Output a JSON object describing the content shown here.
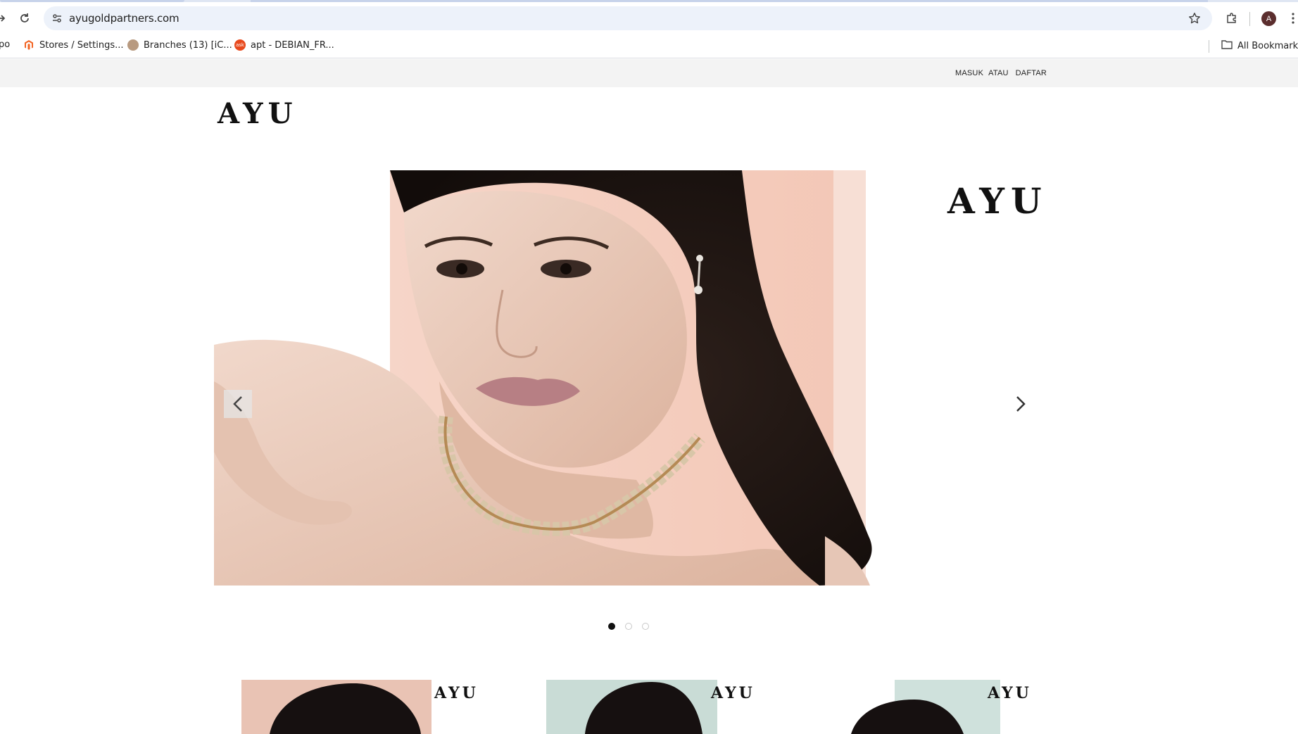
{
  "browser": {
    "url": "ayugoldpartners.com",
    "profile_initial": "A",
    "bookmarks": [
      {
        "label": "po",
        "color": "#ffffff"
      },
      {
        "label": "Stores / Settings...",
        "color": "#f26322"
      },
      {
        "label": "Branches (13) [iC...",
        "color": "#7a5c44"
      },
      {
        "label": "apt - DEBIAN_FR...",
        "color": "#e8491d"
      }
    ],
    "all_bookmarks": "All Bookmarks"
  },
  "site": {
    "topbar": {
      "login": "MASUK",
      "or": "ATAU",
      "register": "DAFTAR"
    },
    "logo": "AYU",
    "hero": {
      "brand_text": "AYU",
      "slides_count": 3,
      "active_slide": 0
    },
    "promos": [
      {
        "brand_text": "AYU",
        "bg": "#e9c3b4"
      },
      {
        "brand_text": "AYU",
        "bg": "#c9dcd6"
      },
      {
        "brand_text": "AYU",
        "bg": "#cfe1dc"
      }
    ]
  }
}
